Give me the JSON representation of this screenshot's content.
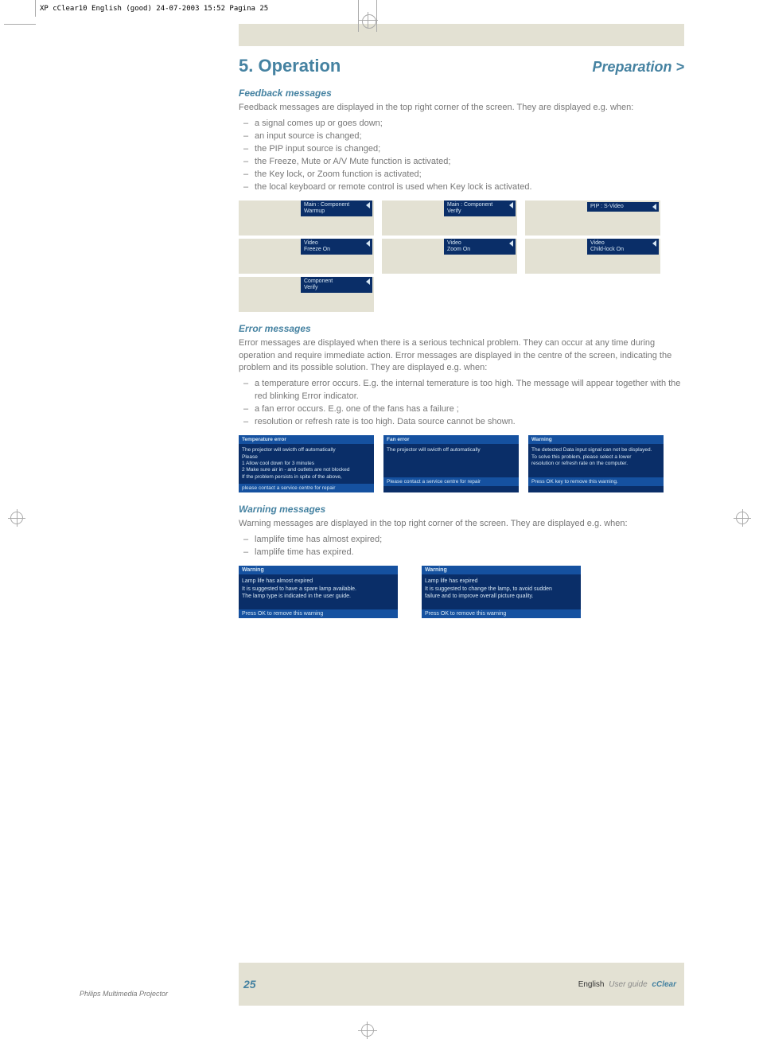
{
  "print_mark": "XP cClear10 English (good)  24-07-2003  15:52  Pagina 25",
  "header": {
    "title": "5. Operation",
    "right": "Preparation >"
  },
  "sections": {
    "feedback": {
      "title": "Feedback messages",
      "intro": "Feedback messages are displayed in the top right corner of the screen. They are displayed e.g. when:",
      "bullets": [
        "a signal comes up or goes down;",
        "an input source is changed;",
        "the PIP input source is changed;",
        "the Freeze, Mute or A/V Mute function is activated;",
        "the Key lock, or Zoom function is activated;"
      ],
      "bullets2": [
        "the local keyboard or remote control is used when Key lock is activated."
      ],
      "osd": {
        "r1c1": {
          "l1": "Main : Component",
          "l2": "Warmup"
        },
        "r1c2": {
          "l1": "Main : Component",
          "l2": "Verify"
        },
        "r1c3": {
          "l1": "PIP :  S-Video",
          "l2": ""
        },
        "r2c1": {
          "l1": "Video",
          "l2": "Freeze On"
        },
        "r2c2": {
          "l1": "Video",
          "l2": "Zoom On"
        },
        "r2c3": {
          "l1": "Video",
          "l2": "Child-lock On"
        },
        "r3c1": {
          "l1": "Component",
          "l2": "Verify"
        }
      }
    },
    "error": {
      "title": "Error messages",
      "intro": "Error messages are displayed when there is a serious technical problem. They can occur at any time during operation and require immediate action. Error messages are displayed in the centre of the screen, indicating the problem and its possible solution. They are displayed e.g. when:",
      "bullets": [
        "a temperature error occurs. E.g. the internal temerature is too high. The message will appear together with the red blinking Error indicator.",
        "a fan error occurs. E.g. one of the fans has a failure ;",
        "resolution or refresh rate is too high. Data source cannot be shown."
      ],
      "tiles": {
        "temp": {
          "bar": "Temperature error",
          "lines": [
            "The projector will swicth off automatically",
            "Please",
            "1 Allow cool down for 3 minutes",
            "2 Make sure air in - and outlets are not blocked",
            "If the problem persists in spite of the above,"
          ],
          "foot": "please contact a service centre for repair"
        },
        "fan": {
          "bar": "Fan error",
          "lines": [
            "The projector will swicth off automatically"
          ],
          "foot": "Please contact a service centre for repair"
        },
        "warn": {
          "bar": "Warning",
          "lines": [
            "The detected Data input signal can not be displayed.",
            "To solve this problem, please select a lower",
            "resolution or refresh rate on the computer."
          ],
          "foot": "Press OK key to remove this warning."
        }
      }
    },
    "warning": {
      "title": "Warning messages",
      "intro": "Warning messages are displayed in the top right corner of the screen. They are displayed e.g. when:",
      "bullets": [
        "lamplife time has almost expired;",
        "lamplife time has expired."
      ],
      "tiles": {
        "almost": {
          "bar": "Warning",
          "lines": [
            "Lamp life has almost expired",
            "It is suggested to have a spare lamp available.",
            "The lamp type is indicated in the user guide."
          ],
          "foot": "Press OK to remove this warning"
        },
        "expired": {
          "bar": "Warning",
          "lines": [
            "Lamp life has expired",
            "It is suggested to change the lamp, to avoid sudden",
            "failure and to improve overall picture quality."
          ],
          "foot": "Press OK to remove this warning"
        }
      }
    }
  },
  "footer": {
    "left": "Philips Multimedia Projector",
    "page": "25",
    "right_en": "English",
    "right_ug": "User guide",
    "right_prod": "cClear"
  }
}
